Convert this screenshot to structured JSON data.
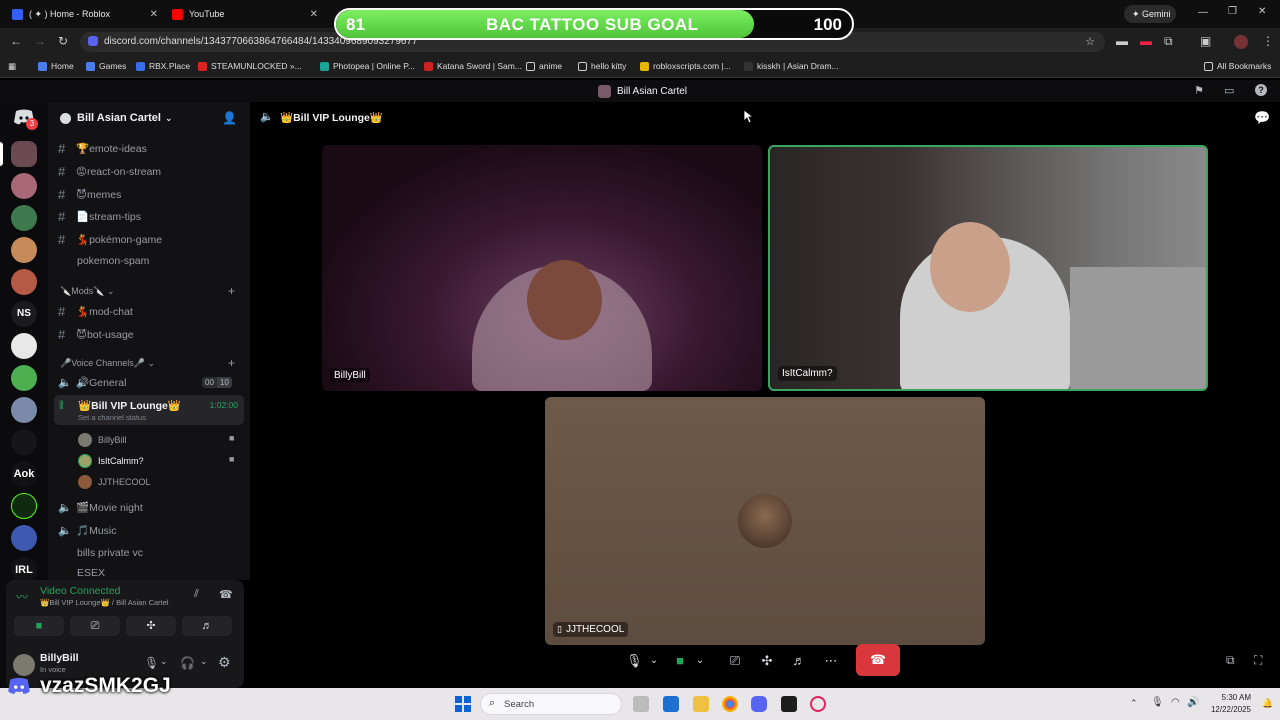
{
  "browser": {
    "tabs": [
      {
        "label": "( ✦ ) Home - Roblox"
      },
      {
        "label": "YouTube"
      }
    ],
    "url": "discord.com/channels/1343770663864766484/1433409689093279677",
    "gemini_label": "Gemini",
    "bookmarks": [
      "Home",
      "Games",
      "RBX.Place",
      "STEAMUNLOCKED »...",
      "Photopea | Online P...",
      "Katana Sword | Sam...",
      "anime",
      "hello kitty",
      "robloxscripts.com |...",
      "kisskh | Asian Dram...",
      "All Bookmarks"
    ]
  },
  "sub_goal": {
    "current": "81",
    "label": "BAC TATTOO SUB GOAL",
    "target": "100",
    "progress": 0.81,
    "color": "#5fd84a"
  },
  "discord": {
    "window_title": "Bill Asian Cartel",
    "server_name": "Bill Asian Cartel",
    "notification_count": "3",
    "text_channels": [
      {
        "label": "🏆emote-ideas"
      },
      {
        "label": "😡react-on-stream"
      },
      {
        "label": "😈memes"
      },
      {
        "label": "📄stream-tips"
      },
      {
        "label": "💃pokémon-game"
      },
      {
        "label": "pokemon-spam"
      }
    ],
    "mods_category": "🔪Mods🔪",
    "mod_channels": [
      {
        "label": "💃mod-chat"
      },
      {
        "label": "😈bot-usage"
      }
    ],
    "voice_category": "🎤Voice Channels🎤",
    "voice_channels": {
      "general": {
        "label": "🔊General",
        "count_a": "00",
        "count_b": "10"
      },
      "active": {
        "label": "👑Bill VIP Lounge👑",
        "timer": "1:02:00",
        "status": "Set a channel status"
      },
      "members": [
        "BillyBill",
        "IsItCalmm?",
        "JJTHECOOL"
      ],
      "others": [
        {
          "label": "🎬Movie night"
        },
        {
          "label": "🎵Music"
        },
        {
          "label": "bills private vc"
        },
        {
          "label": "ESEX"
        }
      ]
    },
    "voice_panel": {
      "status": "Video Connected",
      "location": "👑Bill VIP Lounge👑 / Bill Asian Cartel"
    },
    "user": {
      "name": "BillyBill",
      "status": "In voice"
    },
    "call": {
      "channel_title": "👑Bill VIP Lounge👑",
      "participants": [
        {
          "name": "BillyBill"
        },
        {
          "name": "IsItCalmm?"
        },
        {
          "name": "JJTHECOOL"
        }
      ]
    }
  },
  "watermark": "vzazSMK2GJ",
  "taskbar": {
    "search_placeholder": "Search",
    "time": "5:30 AM",
    "date": "12/22/2025"
  },
  "colors": {
    "accent_green": "#23a55a",
    "hangup_red": "#da373c",
    "active_speaker": "#3ba55d"
  }
}
